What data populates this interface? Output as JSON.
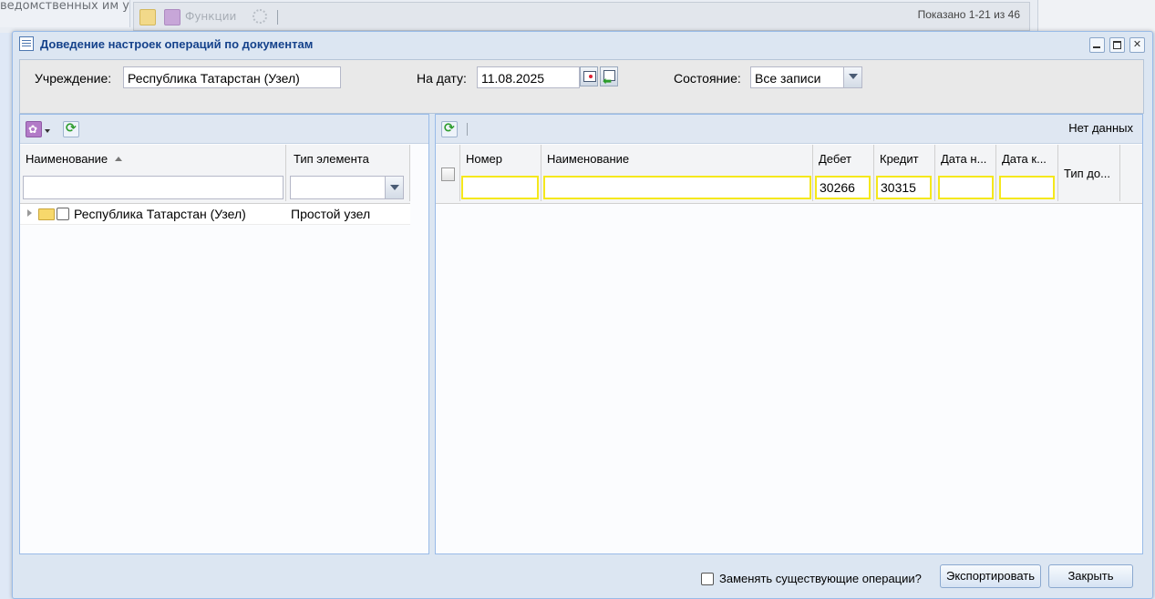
{
  "background": {
    "tab_text": "ведомственных им у",
    "functions_label": "Функции",
    "shown_count": "Показано 1-21 из 46"
  },
  "window": {
    "title": "Доведение настроек операций по документам"
  },
  "filters": {
    "institution_label": "Учреждение:",
    "institution_value": "Республика Татарстан (Узел)",
    "date_label": "На дату:",
    "date_value": "11.08.2025",
    "state_label": "Состояние:",
    "state_value": "Все записи"
  },
  "left_panel": {
    "col_name": "Наименование",
    "col_type": "Тип элемента",
    "rows": [
      {
        "name": "Республика Татарстан (Узел)",
        "type": "Простой узел"
      }
    ]
  },
  "right_panel": {
    "no_data": "Нет данных",
    "columns": {
      "number": "Номер",
      "name": "Наименование",
      "debit": "Дебет",
      "credit": "Кредит",
      "date_start": "Дата н...",
      "date_end": "Дата к...",
      "doc_type": "Тип до..."
    },
    "filters": {
      "number": "",
      "name": "",
      "debit": "30266",
      "credit": "30315",
      "date_start": "",
      "date_end": ""
    }
  },
  "footer": {
    "replace_label": "Заменять существующие операции?",
    "export_label": "Экспортировать",
    "close_label": "Закрыть"
  },
  "colors": {
    "accent_title": "#15428b",
    "filter_highlight": "#f5e81c",
    "window_border": "#99bbe8"
  }
}
